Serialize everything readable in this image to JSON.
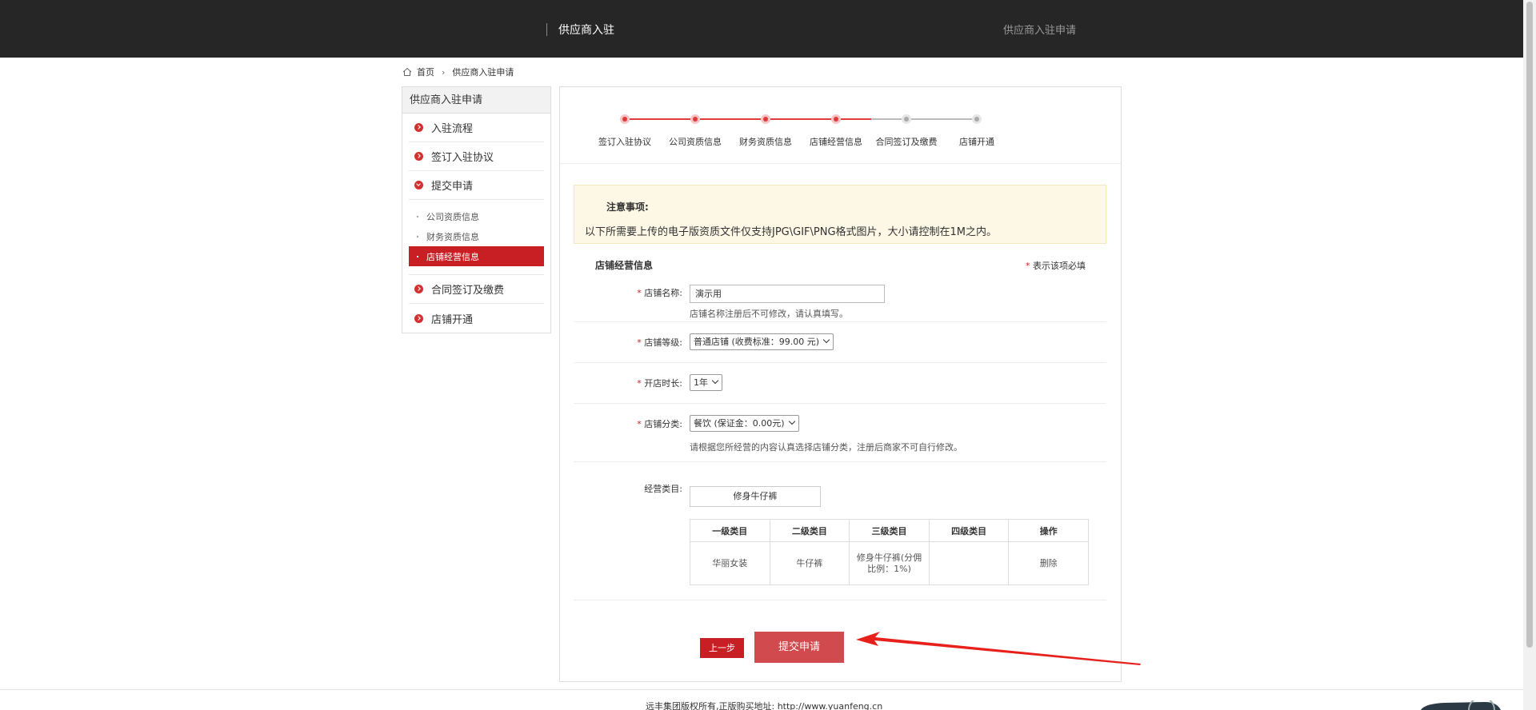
{
  "header": {
    "title": "供应商入驻",
    "right_text": "供应商入驻申请"
  },
  "breadcrumb": {
    "home": "首页",
    "current": "供应商入驻申请"
  },
  "sidebar": {
    "title": "供应商入驻申请",
    "items": [
      {
        "label": "入驻流程"
      },
      {
        "label": "签订入驻协议"
      },
      {
        "label": "提交申请"
      },
      {
        "label": "合同签订及缴费"
      },
      {
        "label": "店铺开通"
      }
    ],
    "subitems": [
      {
        "label": "公司资质信息"
      },
      {
        "label": "财务资质信息"
      },
      {
        "label": "店铺经营信息"
      }
    ]
  },
  "steps": [
    {
      "label": "签订入驻协议",
      "done": true
    },
    {
      "label": "公司资质信息",
      "done": true
    },
    {
      "label": "财务资质信息",
      "done": true
    },
    {
      "label": "店铺经营信息",
      "done": true
    },
    {
      "label": "合同签订及缴费",
      "done": false
    },
    {
      "label": "店铺开通",
      "done": false
    }
  ],
  "colors": {
    "accent": "#c81f24",
    "step_done": "#e2393a",
    "step_todo": "#aaaaaa"
  },
  "notice": {
    "title": "注意事项:",
    "message": "以下所需要上传的电子版资质文件仅支持JPG\\GIF\\PNG格式图片，大小请控制在1M之内。"
  },
  "form": {
    "section_title": "店铺经营信息",
    "required_note": "表示该项必填",
    "required_mark": "*",
    "shop_name": {
      "label": "店铺名称:",
      "value": "演示用",
      "hint": "店铺名称注册后不可修改，请认真填写。"
    },
    "shop_level": {
      "label": "店铺等级:",
      "value": "普通店铺 (收费标准：99.00 元)"
    },
    "duration": {
      "label": "开店时长:",
      "value": "1年"
    },
    "shop_category": {
      "label": "店铺分类:",
      "value": "餐饮 (保证金：0.00元)",
      "hint": "请根据您所经营的内容认真选择店铺分类，注册后商家不可自行修改。"
    },
    "business_category": {
      "label": "经营类目:",
      "button": "修身牛仔裤"
    }
  },
  "category_table": {
    "headers": [
      "一级类目",
      "二级类目",
      "三级类目",
      "四级类目",
      "操作"
    ],
    "rows": [
      [
        "华丽女装",
        "牛仔裤",
        "修身牛仔裤(分佣比例：1%)",
        "",
        "删除"
      ]
    ]
  },
  "buttons": {
    "prev": "上一步",
    "submit": "提交申请"
  },
  "footer": {
    "text": "远丰集团版权所有,正版购买地址:  http://www.yuanfeng.cn"
  }
}
